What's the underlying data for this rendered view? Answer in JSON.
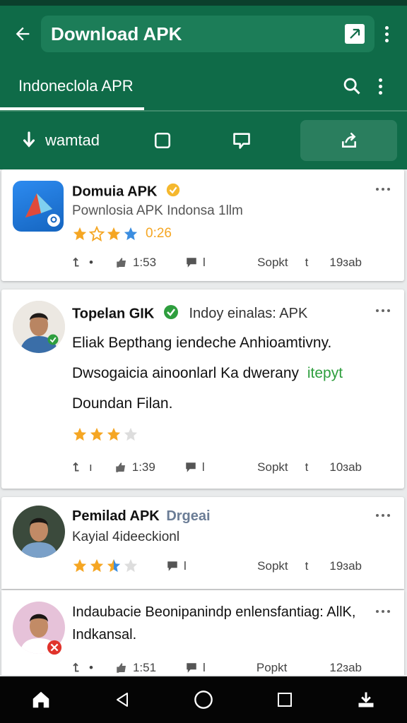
{
  "appbar": {
    "title": "Download APK"
  },
  "subbar": {
    "tab_label": "Indoneclola APR"
  },
  "actionbar": {
    "download_label": "wamtad"
  },
  "cards": [
    {
      "title": "Domuia APK",
      "subtitle": "Pownlosia  APK  Indonsa 1llm",
      "rating": "0:26",
      "stars": 4,
      "stats": [
        "•",
        "1:53",
        "l",
        "Sopkt",
        "t",
        "19ɜab"
      ]
    },
    {
      "title": "Topelan GIK",
      "title_extra": "Indoy einalas: APK",
      "body_lines": [
        "Eliak Bepthang iendeche Anhioamtivny.",
        "Dwsogaicia ainoonlarl Ka dwerany",
        "Doundan Filan."
      ],
      "body_highlight": "itepyt",
      "stars": 3,
      "stats": [
        "ı",
        "1:39",
        "l",
        "Sopkt",
        "t",
        "10ɜab"
      ]
    },
    {
      "title": "Pemilad APK",
      "title_extra": "Drgeai",
      "subtitle": "Kayial 4ideeckionl",
      "stars": 2.5,
      "stats": [
        "l",
        "Sopkt",
        "t",
        "19ɜab"
      ]
    },
    {
      "title": "Indaubacie Beonipanindp enlensfantiag: AllK,",
      "subtitle": "Indkansal.",
      "stats": [
        "•",
        "1:51",
        "l",
        "Popkt",
        "12ɜab"
      ]
    }
  ],
  "colors": {
    "primary": "#0f6b48",
    "star": "#f5a623",
    "star_blue": "#3b8de0",
    "star_empty": "#dddddd",
    "verified_green": "#2e9e3e"
  }
}
